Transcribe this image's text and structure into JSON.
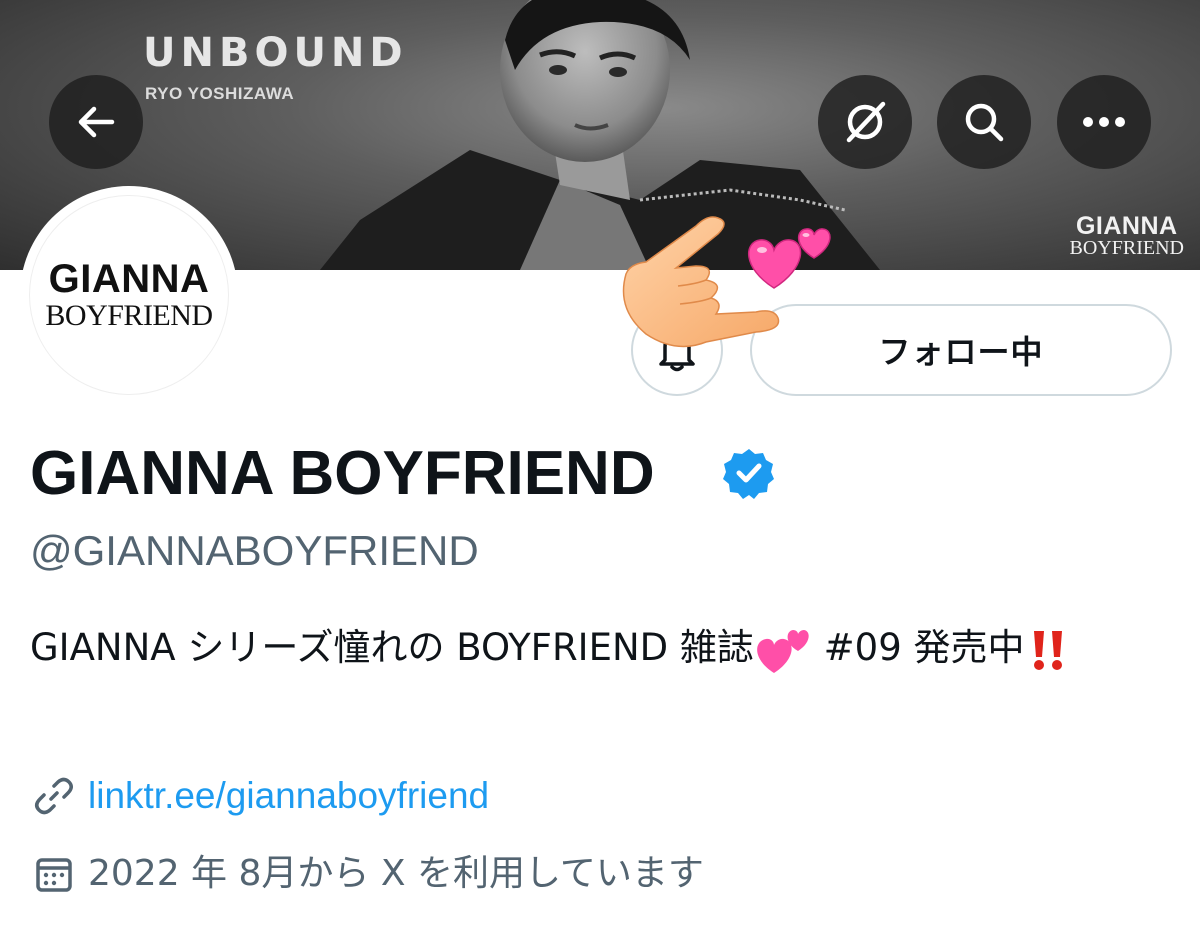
{
  "banner": {
    "magazine_title": "UNBOUND",
    "magazine_subtitle": "RYO YOSHIZAWA",
    "brand_logo_line1": "GIANNA",
    "brand_logo_line2": "BOYFRIEND"
  },
  "header_buttons": [
    {
      "name": "back",
      "icon": "arrow-left-icon"
    },
    {
      "name": "grok",
      "icon": "grok-icon"
    },
    {
      "name": "search",
      "icon": "search-icon"
    },
    {
      "name": "more",
      "icon": "more-horizontal-icon"
    }
  ],
  "avatar": {
    "line1": "GIANNA",
    "line2": "BOYFRIEND"
  },
  "actions": {
    "notification_icon": "bell-icon",
    "follow_label": "フォロー中"
  },
  "profile": {
    "display_name": "GIANNA BOYFRIEND",
    "verified": true,
    "handle": "@GIANNABOYFRIEND",
    "bio_text": "GIANNA シリーズ憧れの BOYFRIEND 雑誌",
    "bio_after_hearts": " #09 発売中",
    "bio_emojis": [
      "two-hearts-emoji",
      "double-exclamation-emoji"
    ],
    "link": "linktr.ee/giannaboyfriend",
    "joined": "2022 年 8月から X を利用しています"
  },
  "colors": {
    "accent": "#1d9bf0",
    "secondary_text": "#536471",
    "border": "#cfd9de",
    "heart": "#ff4fa8",
    "exclamation": "#e0241b"
  }
}
